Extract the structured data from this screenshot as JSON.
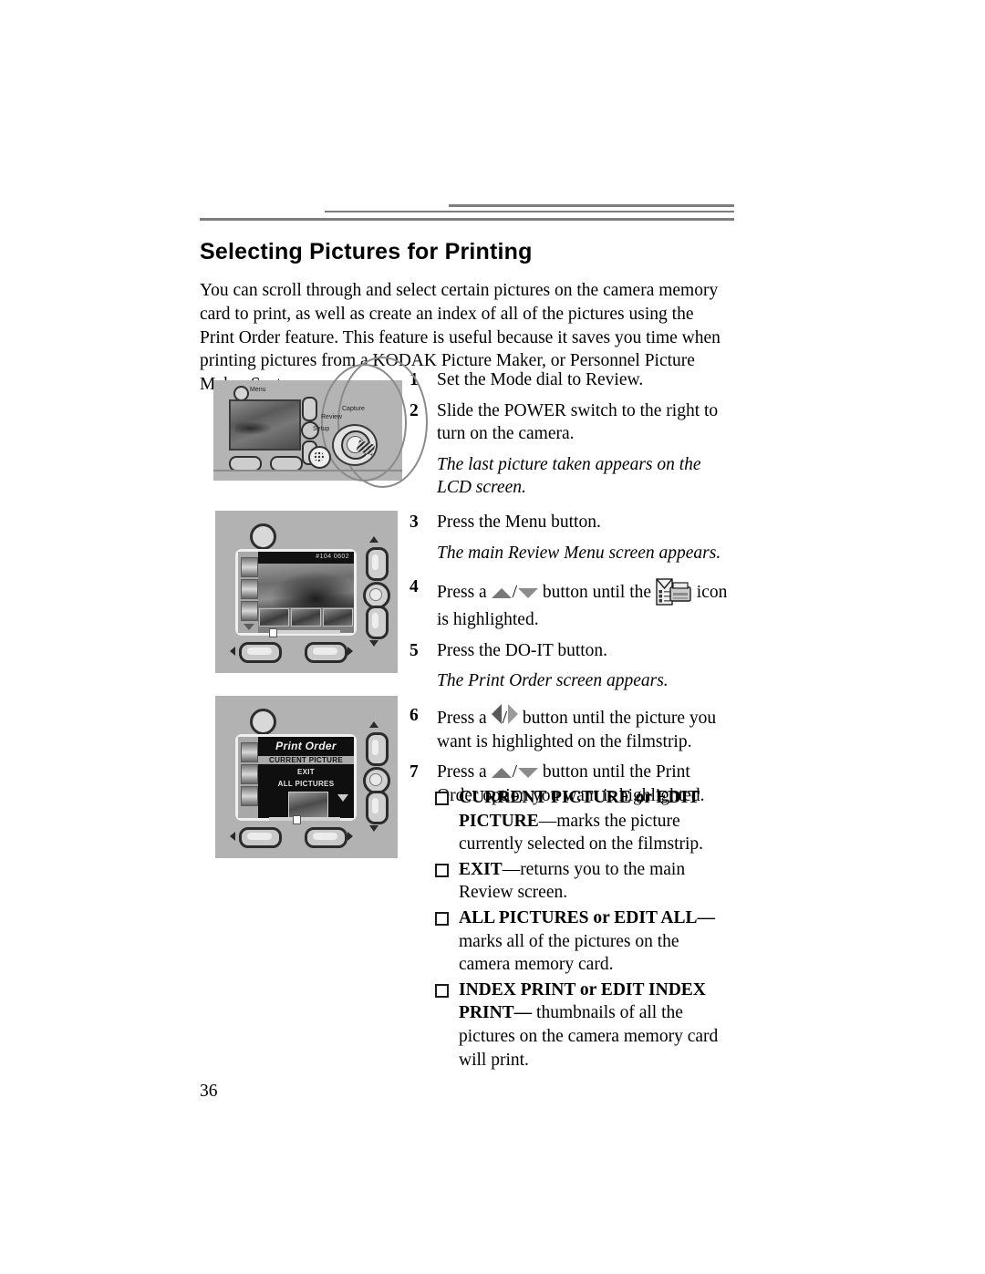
{
  "document": {
    "heading": "Selecting Pictures for Printing",
    "intro": "You can scroll through and select certain pictures on the camera memory card to print, as well as create an index of all of the pictures using the Print Order feature. This feature is useful because it saves you time when printing pictures from a KODAK Picture Maker, or Personnel Picture Maker Systems.",
    "page_number": "36"
  },
  "steps": [
    {
      "num": "1",
      "text": "Set the Mode dial to Review."
    },
    {
      "num": "2",
      "text": "Slide the POWER switch to the right to turn on the camera."
    },
    {
      "num": "3",
      "text": "Press the Menu button."
    },
    {
      "num": "4",
      "pre": "Press a",
      "mid": "button until the",
      "post": "icon is highlighted."
    },
    {
      "num": "5",
      "text": "Press the DO-IT button."
    },
    {
      "num": "6",
      "pre": "Press a",
      "post": "button until the picture you want is highlighted on the filmstrip."
    },
    {
      "num": "7",
      "pre": "Press a",
      "post": "button until the Print Order option you want is highlighted."
    }
  ],
  "notes": {
    "after_step2": "The last picture taken appears on the LCD screen.",
    "after_step3": "The main Review Menu screen appears.",
    "after_step5": "The Print Order screen appears."
  },
  "bullets": [
    {
      "term": "CURRENT PICTURE or EDIT PICTURE",
      "desc": "—marks the picture currently selected on the filmstrip."
    },
    {
      "term": "EXIT",
      "desc": "—returns you to the main Review screen."
    },
    {
      "term": "ALL PICTURES or EDIT ALL—",
      "desc": " marks all of the pictures on the camera memory card."
    },
    {
      "term": "INDEX PRINT or EDIT INDEX PRINT—",
      "desc": " thumbnails of all the pictures on the camera memory card will print."
    }
  ],
  "figures": {
    "camera_back": {
      "menu_label": "Menu",
      "dial_labels": {
        "capture": "Capture",
        "review": "Review",
        "setup": "Setup"
      }
    },
    "review_menu": {
      "header_text": "#104 0602"
    },
    "print_order": {
      "title": "Print Order",
      "items": [
        "CURRENT PICTURE",
        "EXIT",
        "ALL PICTURES"
      ],
      "selected": "CURRENT PICTURE"
    }
  },
  "colors": {
    "rule": "#7d7d7d",
    "camera_body": "#b2b2b2",
    "lcd_dark": "#0f0f0f",
    "text": "#000000"
  }
}
